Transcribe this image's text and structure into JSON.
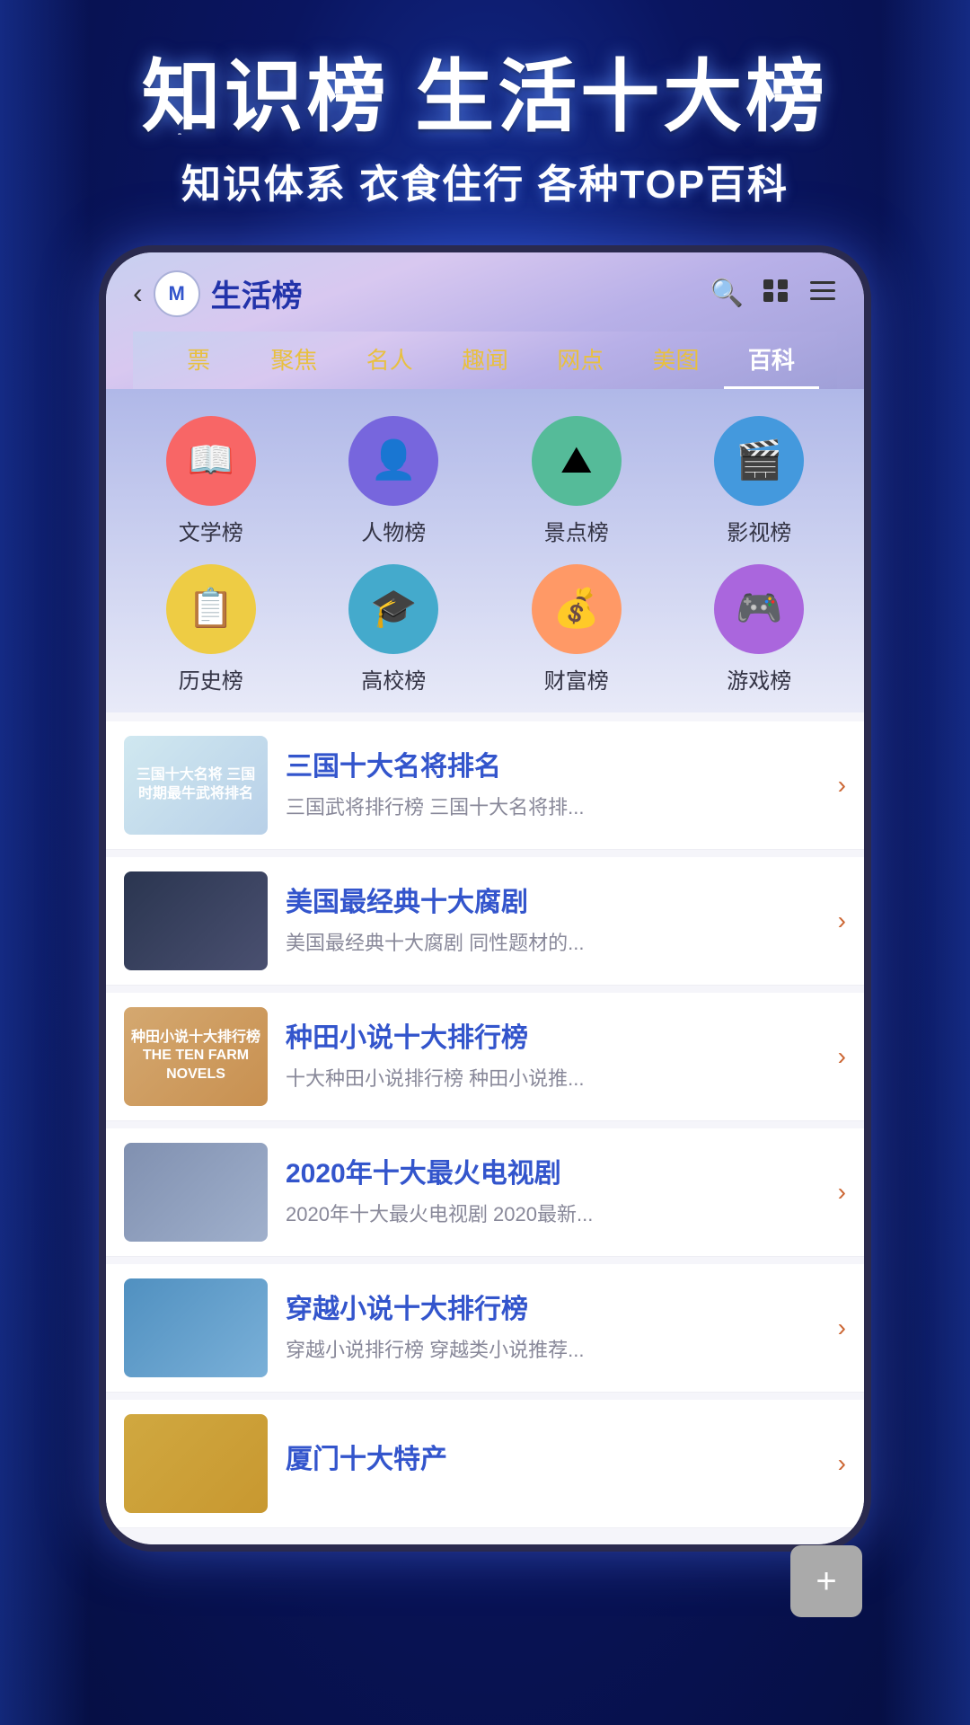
{
  "hero": {
    "title": "知识榜 生活十大榜",
    "subtitle": "知识体系 衣食住行 各种TOP百科"
  },
  "nav": {
    "back_label": "‹",
    "logo_text": "M",
    "title": "生活榜",
    "search_icon": "🔍",
    "grid_icon": "⊞",
    "menu_icon": "☰"
  },
  "tabs": [
    {
      "label": "票",
      "active": false
    },
    {
      "label": "聚焦",
      "active": false
    },
    {
      "label": "名人",
      "active": false
    },
    {
      "label": "趣闻",
      "active": false
    },
    {
      "label": "网点",
      "active": false
    },
    {
      "label": "美图",
      "active": false
    },
    {
      "label": "百科",
      "active": true
    }
  ],
  "categories": [
    {
      "id": "literature",
      "label": "文学榜",
      "icon": "📖",
      "color": "#e85555",
      "bg": "#f86666"
    },
    {
      "id": "people",
      "label": "人物榜",
      "icon": "👤",
      "color": "#6655cc",
      "bg": "#7766dd"
    },
    {
      "id": "attractions",
      "label": "景点榜",
      "icon": "⛰",
      "color": "#44aa88",
      "bg": "#55bb99"
    },
    {
      "id": "film",
      "label": "影视榜",
      "icon": "🎬",
      "color": "#3388cc",
      "bg": "#4499dd"
    },
    {
      "id": "history",
      "label": "历史榜",
      "icon": "📋",
      "color": "#ddaa33",
      "bg": "#eecc44"
    },
    {
      "id": "university",
      "label": "高校榜",
      "icon": "🎓",
      "color": "#3399bb",
      "bg": "#44aacc"
    },
    {
      "id": "wealth",
      "label": "财富榜",
      "icon": "💰",
      "color": "#ee8855",
      "bg": "#ff9966"
    },
    {
      "id": "games",
      "label": "游戏榜",
      "icon": "🎮",
      "color": "#9955cc",
      "bg": "#aa66dd"
    }
  ],
  "list_items": [
    {
      "id": "item1",
      "title": "三国十大名将排名",
      "desc": "三国武将排行榜 三国十大名将排...",
      "thumb_label": "三国十大名将\n三国时期最牛武将排名",
      "thumb_class": "thumb-1"
    },
    {
      "id": "item2",
      "title": "美国最经典十大腐剧",
      "desc": "美国最经典十大腐剧 同性题材的...",
      "thumb_label": "",
      "thumb_class": "thumb-2"
    },
    {
      "id": "item3",
      "title": "种田小说十大排行榜",
      "desc": "十大种田小说排行榜 种田小说推...",
      "thumb_label": "种田小说十大排行榜\nTHE TEN FARM NOVELS",
      "thumb_class": "thumb-3"
    },
    {
      "id": "item4",
      "title": "2020年十大最火电视剧",
      "desc": "2020年十大最火电视剧 2020最新...",
      "thumb_label": "",
      "thumb_class": "thumb-4"
    },
    {
      "id": "item5",
      "title": "穿越小说十大排行榜",
      "desc": "穿越小说排行榜 穿越类小说推荐...",
      "thumb_label": "",
      "thumb_class": "thumb-5"
    },
    {
      "id": "item6",
      "title": "厦门十大特产",
      "desc": "",
      "thumb_label": "",
      "thumb_class": "thumb-6"
    }
  ],
  "fab": {
    "icon": "+"
  }
}
